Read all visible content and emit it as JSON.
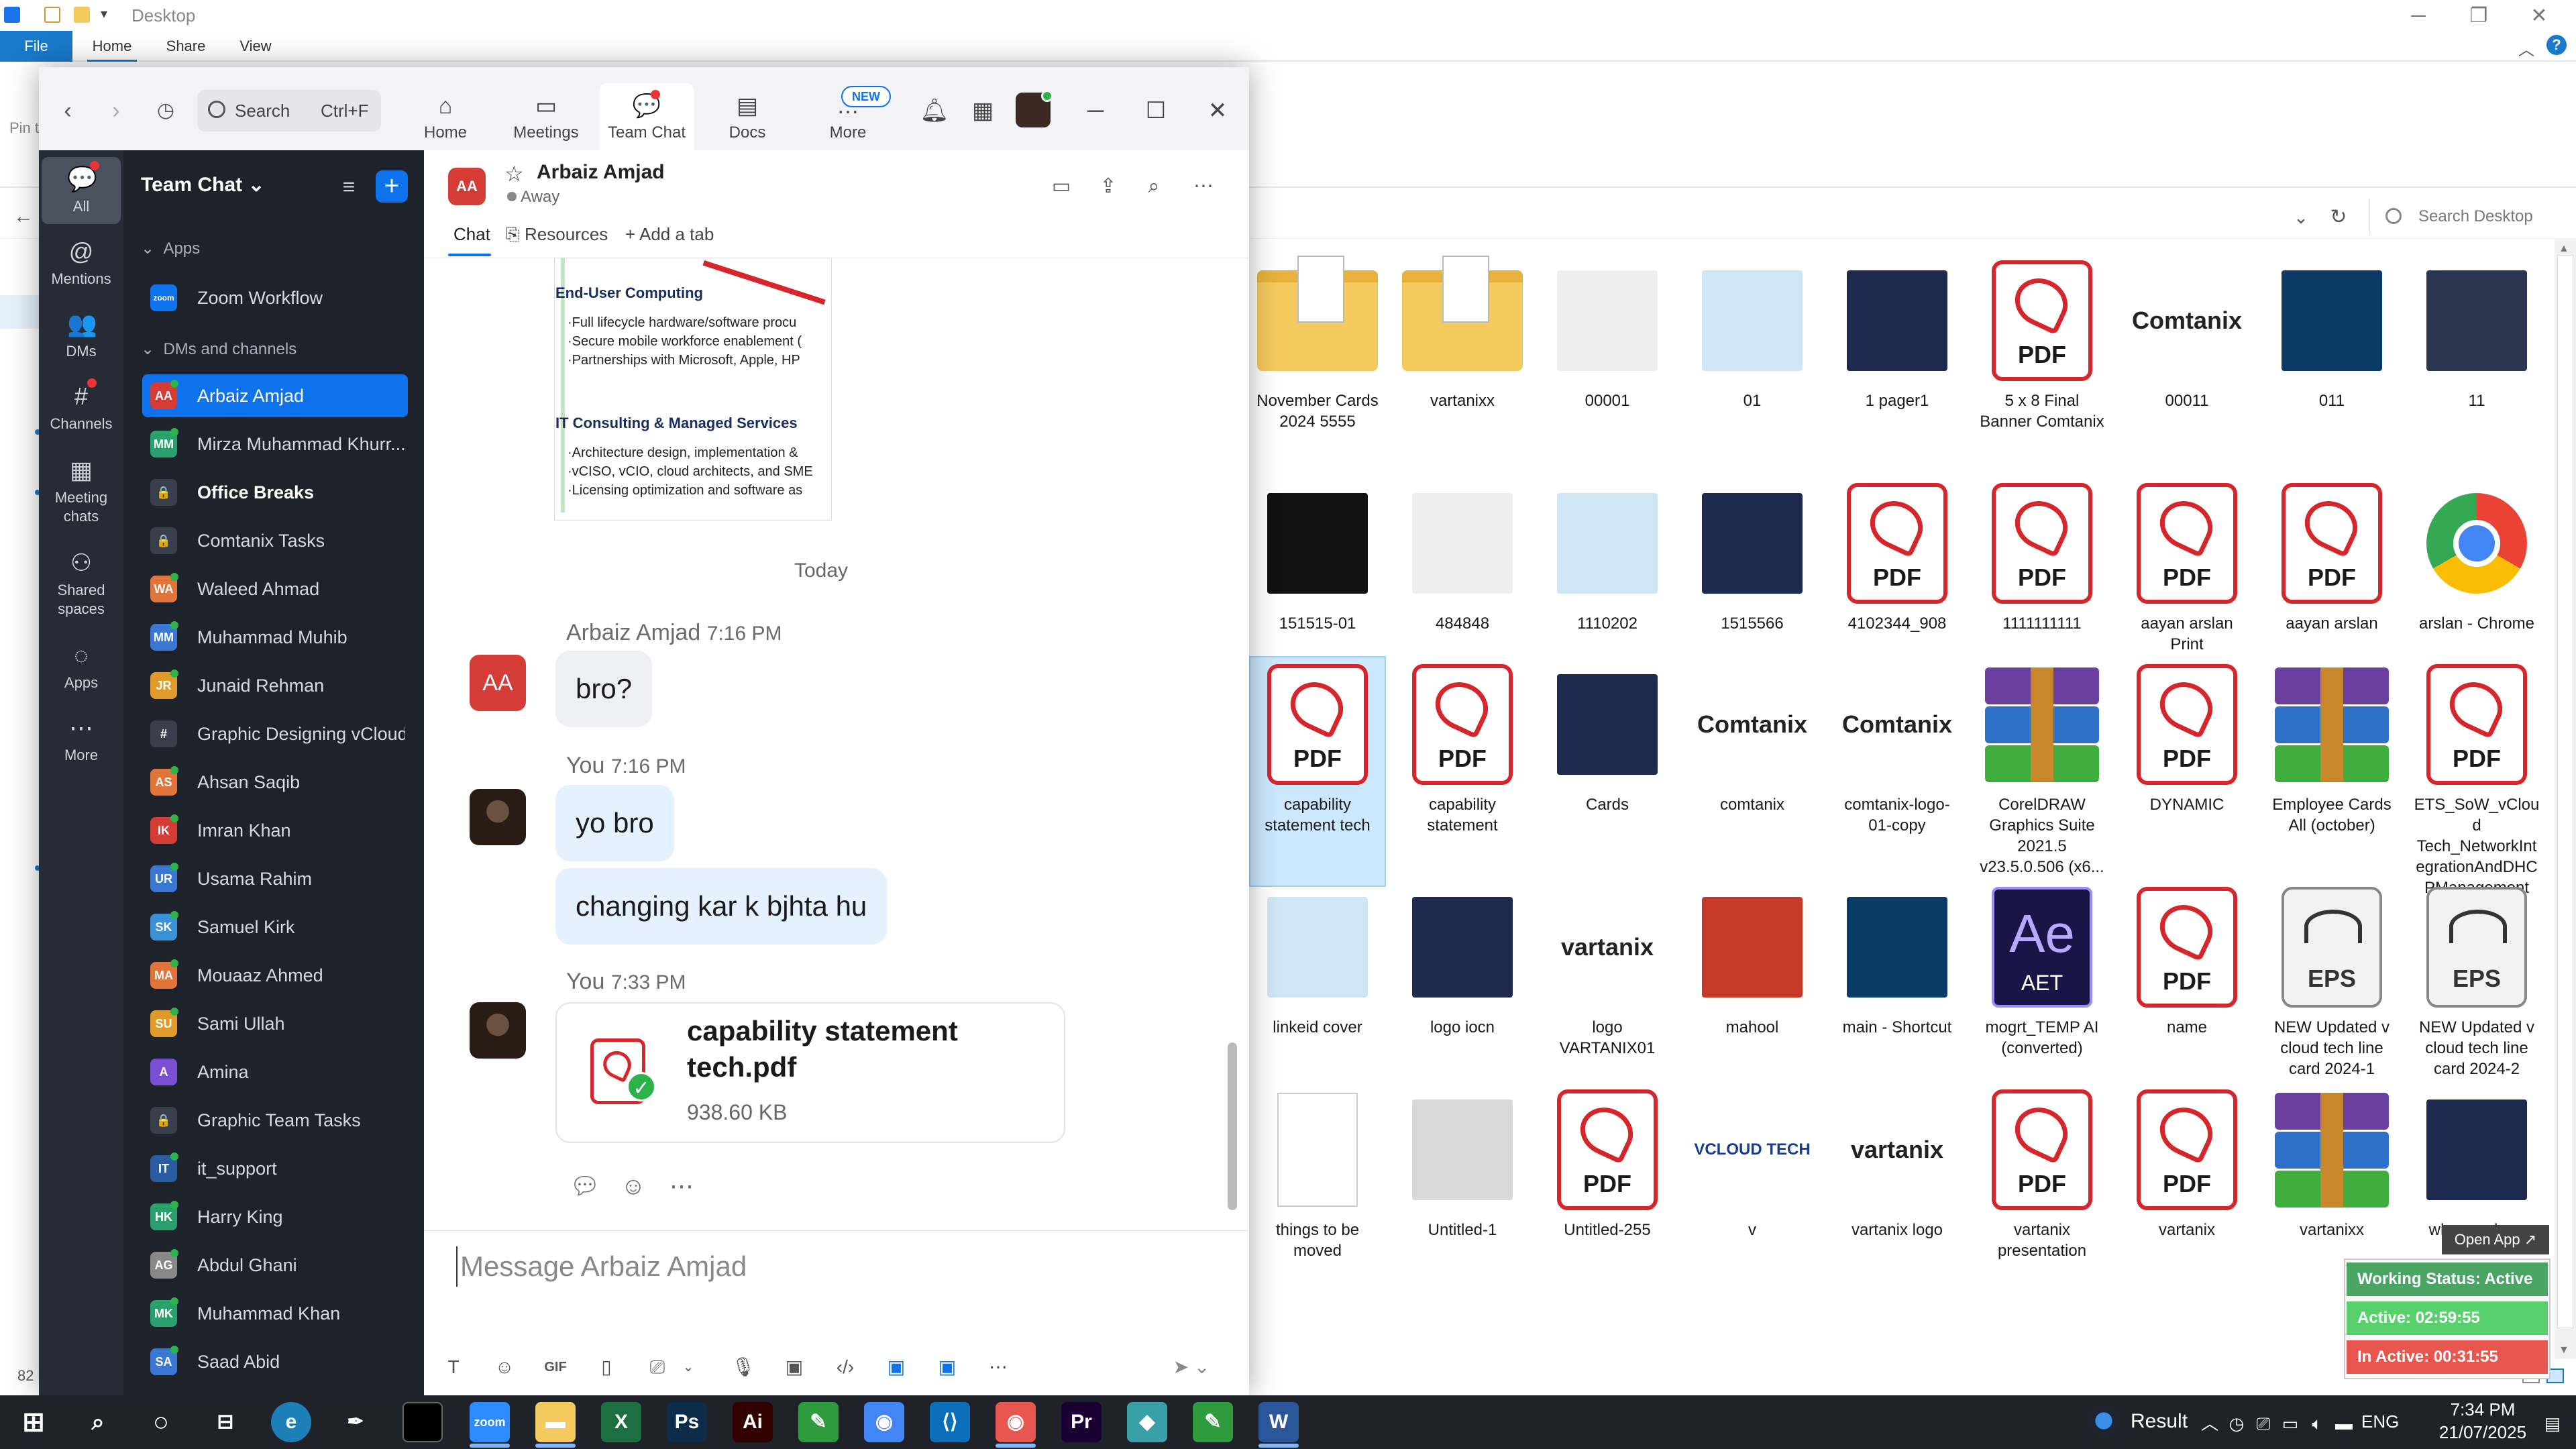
{
  "explorer": {
    "title": "Desktop",
    "tabs": {
      "file": "File",
      "home": "Home",
      "share": "Share",
      "view": "View"
    },
    "search_placeholder": "Search Desktop",
    "status_count": "82",
    "left_pin_label": "Pin t",
    "items": [
      {
        "name": "November Cards 2024 5555",
        "kind": "folder"
      },
      {
        "name": "vartanixx",
        "kind": "folder"
      },
      {
        "name": "00001",
        "kind": "image"
      },
      {
        "name": "01",
        "kind": "image"
      },
      {
        "name": "1 pager1",
        "kind": "image"
      },
      {
        "name": "5 x 8 Final Banner Comtanix",
        "kind": "pdf"
      },
      {
        "name": "00011",
        "kind": "logo",
        "logo_text": "Comtanix"
      },
      {
        "name": "011",
        "kind": "image"
      },
      {
        "name": "11",
        "kind": "image"
      },
      {
        "name": "151515-01",
        "kind": "image"
      },
      {
        "name": "484848",
        "kind": "image"
      },
      {
        "name": "1110202",
        "kind": "image"
      },
      {
        "name": "1515566",
        "kind": "image"
      },
      {
        "name": "4102344_908",
        "kind": "pdf"
      },
      {
        "name": "1111111111",
        "kind": "pdf"
      },
      {
        "name": "aayan arslan Print",
        "kind": "pdf"
      },
      {
        "name": "aayan arslan",
        "kind": "pdf"
      },
      {
        "name": "arslan - Chrome",
        "kind": "chrome"
      },
      {
        "name": "capability statement tech",
        "kind": "pdf",
        "selected": true
      },
      {
        "name": "capability statement",
        "kind": "pdf"
      },
      {
        "name": "Cards",
        "kind": "image"
      },
      {
        "name": "comtanix",
        "kind": "logo",
        "logo_text": "Comtanix"
      },
      {
        "name": "comtanix-logo-01-copy",
        "kind": "logo",
        "logo_text": "Comtanix"
      },
      {
        "name": "CorelDRAW Graphics Suite 2021.5 v23.5.0.506 (x6...",
        "kind": "rar"
      },
      {
        "name": "DYNAMIC",
        "kind": "pdf"
      },
      {
        "name": "Employee Cards All (october)",
        "kind": "rar"
      },
      {
        "name": "ETS_SoW_vCloud Tech_NetworkIntegrationAndDHCPManagement",
        "kind": "pdf"
      },
      {
        "name": "linkeid cover",
        "kind": "image"
      },
      {
        "name": "logo iocn",
        "kind": "image"
      },
      {
        "name": "logo VARTANIX01",
        "kind": "logo",
        "logo_text": "vartanix"
      },
      {
        "name": "mahool",
        "kind": "image"
      },
      {
        "name": "main - Shortcut",
        "kind": "image"
      },
      {
        "name": "mogrt_TEMP AI (converted)",
        "kind": "ae",
        "big": "Ae",
        "small": "AET"
      },
      {
        "name": "name",
        "kind": "pdf"
      },
      {
        "name": "NEW Updated v cloud tech line card 2024-1",
        "kind": "eps"
      },
      {
        "name": "NEW Updated v cloud tech line card 2024-2",
        "kind": "eps"
      },
      {
        "name": "things to be moved",
        "kind": "doc"
      },
      {
        "name": "Untitled-1",
        "kind": "image"
      },
      {
        "name": "Untitled-255",
        "kind": "pdf"
      },
      {
        "name": "v",
        "kind": "logo",
        "logo_text": "VCLOUD TECH"
      },
      {
        "name": "vartanix logo",
        "kind": "logo",
        "logo_text": "vartanix"
      },
      {
        "name": "vartanix presentation",
        "kind": "pdf"
      },
      {
        "name": "vartanix",
        "kind": "pdf"
      },
      {
        "name": "vartanixx",
        "kind": "rar"
      },
      {
        "name": "wheman logo",
        "kind": "image"
      }
    ],
    "pdf_label": "PDF",
    "eps_label": "EPS"
  },
  "work_status": {
    "open_app": "Open App ↗",
    "status": "Working Status: Active",
    "active": "Active: 02:59:55",
    "inactive": "In Active: 00:31:55"
  },
  "zoom": {
    "search_label": "Search",
    "search_shortcut": "Ctrl+F",
    "nav": [
      {
        "label": "Home",
        "icon": "home-icon",
        "glyph": "⌂"
      },
      {
        "label": "Meetings",
        "icon": "video-icon",
        "glyph": "▭"
      },
      {
        "label": "Team Chat",
        "icon": "chat-icon",
        "glyph": "💬"
      },
      {
        "label": "Docs",
        "icon": "docs-icon",
        "glyph": "▤"
      },
      {
        "label": "More",
        "icon": "more-icon",
        "glyph": "…"
      }
    ],
    "new_badge": "NEW",
    "rail": [
      {
        "label": "All",
        "glyph": "💬"
      },
      {
        "label": "Mentions",
        "glyph": "@"
      },
      {
        "label": "DMs",
        "glyph": "👥"
      },
      {
        "label": "Channels",
        "glyph": "#"
      },
      {
        "label": "Meeting chats",
        "glyph": "▦"
      },
      {
        "label": "Shared spaces",
        "glyph": "⚇"
      },
      {
        "label": "Apps",
        "glyph": "◌"
      },
      {
        "label": "More",
        "glyph": "⋯"
      }
    ],
    "list": {
      "title": "Team Chat ⌄",
      "apps_section": "Apps",
      "dms_section": "DMs and channels",
      "zoom_workflow": {
        "label": "Zoom Workflow",
        "avatar": "zoom"
      },
      "rows": [
        {
          "label": "Arbaiz Amjad",
          "avatar": "AA",
          "color": "#d43c35",
          "active": true,
          "online": true
        },
        {
          "label": "Mirza Muhammad Khurr...",
          "avatar": "MM",
          "color": "#2aa06e",
          "online": true
        },
        {
          "label": "Office Breaks",
          "avatar": "🔒",
          "color": "#3a404b",
          "bold": true
        },
        {
          "label": "Comtanix Tasks",
          "avatar": "🔒",
          "color": "#3a404b"
        },
        {
          "label": "Waleed Ahmad",
          "avatar": "WA",
          "color": "#e0743a",
          "online": true
        },
        {
          "label": "Muhammad Muhib",
          "avatar": "MM",
          "color": "#3a78d4",
          "online": true
        },
        {
          "label": "Junaid Rehman",
          "avatar": "JR",
          "color": "#e09a2a",
          "online": true
        },
        {
          "label": "Graphic Designing vCloud",
          "avatar": "#",
          "color": "#3a404b"
        },
        {
          "label": "Ahsan Saqib",
          "avatar": "AS",
          "color": "#e0743a",
          "online": true
        },
        {
          "label": "Imran Khan",
          "avatar": "IK",
          "color": "#d43c35",
          "online": true
        },
        {
          "label": "Usama Rahim",
          "avatar": "UR",
          "color": "#3a78d4",
          "online": true
        },
        {
          "label": "Samuel Kirk",
          "avatar": "SK",
          "color": "#3a90d4",
          "online": true
        },
        {
          "label": "Mouaaz Ahmed",
          "avatar": "MA",
          "color": "#e0743a",
          "online": true
        },
        {
          "label": "Sami Ullah",
          "avatar": "SU",
          "color": "#e09a2a",
          "online": true
        },
        {
          "label": "Amina",
          "avatar": "A",
          "color": "#7a4fd4"
        },
        {
          "label": "Graphic Team Tasks",
          "avatar": "🔒",
          "color": "#3a404b"
        },
        {
          "label": "it_support",
          "avatar": "IT",
          "color": "#2a5ca0",
          "online": true
        },
        {
          "label": "Harry King",
          "avatar": "HK",
          "color": "#2aa06e",
          "online": true
        },
        {
          "label": "Abdul Ghani",
          "avatar": "AG",
          "color": "#888888",
          "online": true
        },
        {
          "label": "Muhammad Khan",
          "avatar": "MK",
          "color": "#2aa06e",
          "online": true
        },
        {
          "label": "Saad Abid",
          "avatar": "SA",
          "color": "#3a78d4",
          "online": true
        }
      ]
    },
    "chat": {
      "contact_name": "Arbaiz Amjad",
      "contact_initials": "AA",
      "contact_status": "Away",
      "tabs": {
        "chat": "Chat",
        "resources": "Resources",
        "add_tab": "+ Add a tab"
      },
      "doc_snippet": {
        "heading1": "End-User Computing",
        "lines1": [
          "·Full lifecycle hardware/software procu",
          "·Secure mobile workforce enablement (",
          "·Partnerships with Microsoft, Apple, HP"
        ],
        "heading2": "IT Consulting & Managed Services",
        "lines2": [
          "·Architecture design, implementation &",
          "·vCISO, vCIO, cloud architects, and SME",
          "·Licensing optimization and software as"
        ]
      },
      "day_separator": "Today",
      "messages": [
        {
          "sender": "Arbaiz Amjad",
          "time": "7:16 PM",
          "texts": [
            "bro?"
          ]
        },
        {
          "sender": "You",
          "time": "7:16 PM",
          "texts": [
            "yo bro",
            "changing kar k bjhta hu"
          ]
        },
        {
          "sender": "You",
          "time": "7:33 PM",
          "file": {
            "name": "capability statement tech.pdf",
            "size": "938.60 KB"
          }
        }
      ],
      "composer_placeholder": "Message Arbaiz Amjad"
    }
  },
  "taskbar": {
    "weather": "Result",
    "lang": "ENG",
    "time": "7:34 PM",
    "date": "21/07/2025",
    "apps": [
      {
        "name": "zoom",
        "label": "zoom",
        "color": "#2d8cff",
        "active": true
      },
      {
        "name": "file-explorer",
        "label": "▬",
        "color": "#f4c95d",
        "active": true
      },
      {
        "name": "excel",
        "label": "X",
        "color": "#1d6f42"
      },
      {
        "name": "photoshop",
        "label": "Ps",
        "color": "#0c2c4a"
      },
      {
        "name": "illustrator",
        "label": "Ai",
        "color": "#330000"
      },
      {
        "name": "coreldraw",
        "label": "✎",
        "color": "#2e9c3e"
      },
      {
        "name": "chrome",
        "label": "◉",
        "color": "#4285f4"
      },
      {
        "name": "vscode",
        "label": "⟨⟩",
        "color": "#0a6ebd"
      },
      {
        "name": "chrome-2",
        "label": "◉",
        "color": "#e8574f",
        "active": true
      },
      {
        "name": "premiere",
        "label": "Pr",
        "color": "#1a0033"
      },
      {
        "name": "app-diamond",
        "label": "◆",
        "color": "#3aa0a8"
      },
      {
        "name": "coreldraw-2",
        "label": "✎",
        "color": "#2e9c3e"
      },
      {
        "name": "word",
        "label": "W",
        "color": "#2b579a",
        "active": true
      }
    ]
  }
}
